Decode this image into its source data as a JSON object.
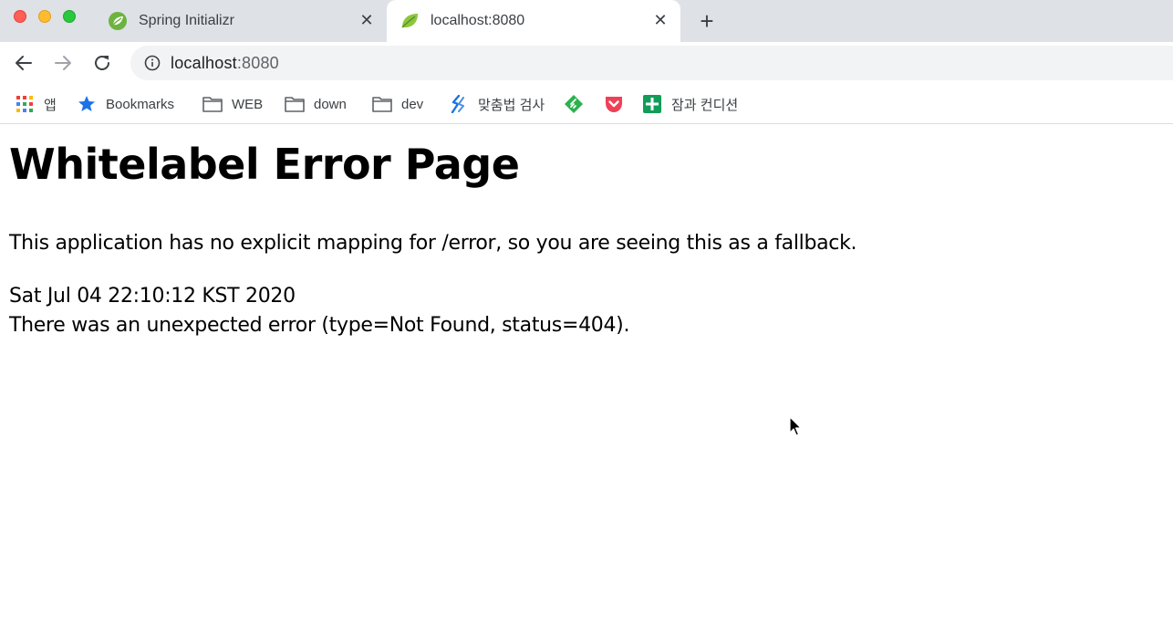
{
  "tabs": [
    {
      "title": "Spring Initializr",
      "favicon": "spring-leaf-icon",
      "active": false
    },
    {
      "title": "localhost:8080",
      "favicon": "spring-boot-leaf-icon",
      "active": true
    }
  ],
  "new_tab_label": "+",
  "address_bar": {
    "host": "localhost",
    "port": ":8080"
  },
  "bookmarks": {
    "apps": "앱",
    "bookmarks": "Bookmarks",
    "web": "WEB",
    "down": "down",
    "dev": "dev",
    "spell": "맞춤법 검사",
    "sheets": "잠과 컨디션"
  },
  "page": {
    "title": "Whitelabel Error Page",
    "message": "This application has no explicit mapping for /error, so you are seeing this as a fallback.",
    "timestamp": "Sat Jul 04 22:10:12 KST 2020",
    "error": "There was an unexpected error (type=Not Found, status=404)."
  },
  "colors": {
    "tabstrip": "#dee1e6",
    "spring_green": "#6db33f",
    "star_blue": "#1a73e8",
    "pocket_red": "#ef4056",
    "sheets_green": "#0f9d58"
  }
}
